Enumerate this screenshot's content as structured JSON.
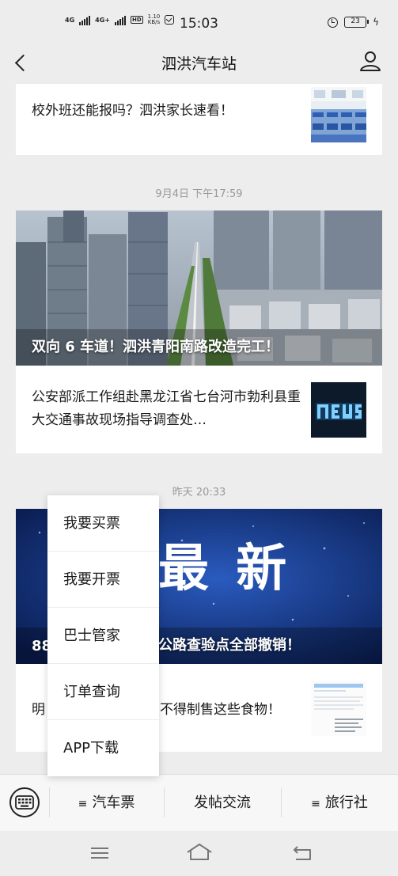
{
  "status_bar": {
    "net1": "4G",
    "net2": "4G+",
    "hd": "HD",
    "speed_value": "1.10",
    "speed_unit": "KB/s",
    "time": "15:03",
    "battery": "23"
  },
  "nav": {
    "title": "泗洪汽车站",
    "back_icon": "back-arrow-icon",
    "profile_icon": "user-icon"
  },
  "feed": {
    "card1": {
      "article_title": "校外班还能报吗？泗洪家长速看！"
    },
    "group2": {
      "timestamp": "9月4日 下午17:59",
      "cover_title": "双向 6 车道！泗洪青阳南路改造完工！",
      "article_title": "公安部派工作组赴黑龙江省七台河市勃利县重大交通事故现场指导调查处…"
    },
    "group3": {
      "timestamp": "昨天 20:33",
      "cover_big_text": "最 新",
      "cover_title_left": "88",
      "cover_title_right": "公路查验点全部撤销！",
      "article_title_left": "明",
      "article_title_right": "不得制售这些食物！"
    }
  },
  "popup_menu": {
    "items": [
      "我要买票",
      "我要开票",
      "巴士管家",
      "订单查询",
      "APP下载"
    ]
  },
  "bottom_menu": {
    "keyboard_icon": "keyboard-icon",
    "items": [
      {
        "label": "汽车票",
        "prefix": "≡"
      },
      {
        "label": "发帖交流",
        "prefix": ""
      },
      {
        "label": "旅行社",
        "prefix": "≡"
      }
    ]
  },
  "colors": {
    "background": "#ededed",
    "card": "#ffffff",
    "timestamp": "#999999"
  }
}
